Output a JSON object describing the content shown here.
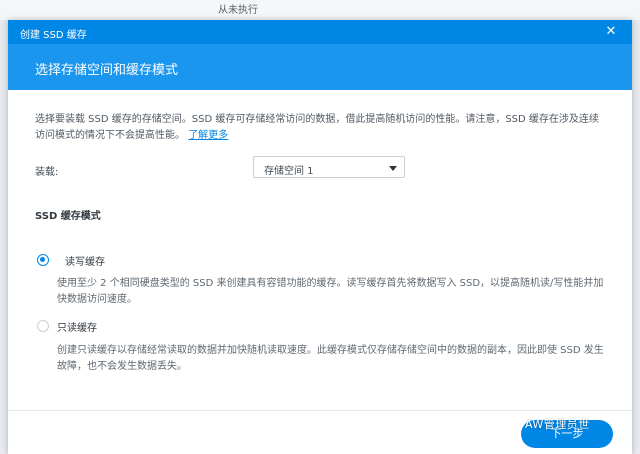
{
  "background": {
    "top_text": "从未执行"
  },
  "dialog": {
    "title": "创建 SSD 缓存",
    "header": "选择存储空间和缓存模式",
    "description": "选择要装载 SSD 缓存的存储空间。SSD 缓存可存储经常访问的数据，借此提高随机访问的性能。请注意，SSD 缓存在涉及连续访问模式的情况下不会提高性能。",
    "learn_more": "了解更多",
    "mount_label": "装载:",
    "mount_value": "存储空间 1",
    "mode_title": "SSD 缓存模式",
    "options": [
      {
        "label": "读写缓存",
        "selected": true,
        "desc": "使用至少 2 个相同硬盘类型的 SSD 来创建具有容错功能的缓存。读写缓存首先将数据写入 SSD，以提高随机读/写性能并加快数据访问速度。"
      },
      {
        "label": "只读缓存",
        "selected": false,
        "desc": "创建只读缓存以存储经常读取的数据并加快随机读取速度。此缓存模式仅存储存储空间中的数据的副本，因此即使 SSD 发生故障，也不会发生数据丢失。"
      }
    ],
    "next_button": "下一步",
    "watermark": "AW管理员世"
  },
  "colors": {
    "accent": "#0086e5",
    "header": "#1a96ef"
  },
  "icons": {
    "close": "close-icon",
    "caret": "chevron-down-icon"
  }
}
